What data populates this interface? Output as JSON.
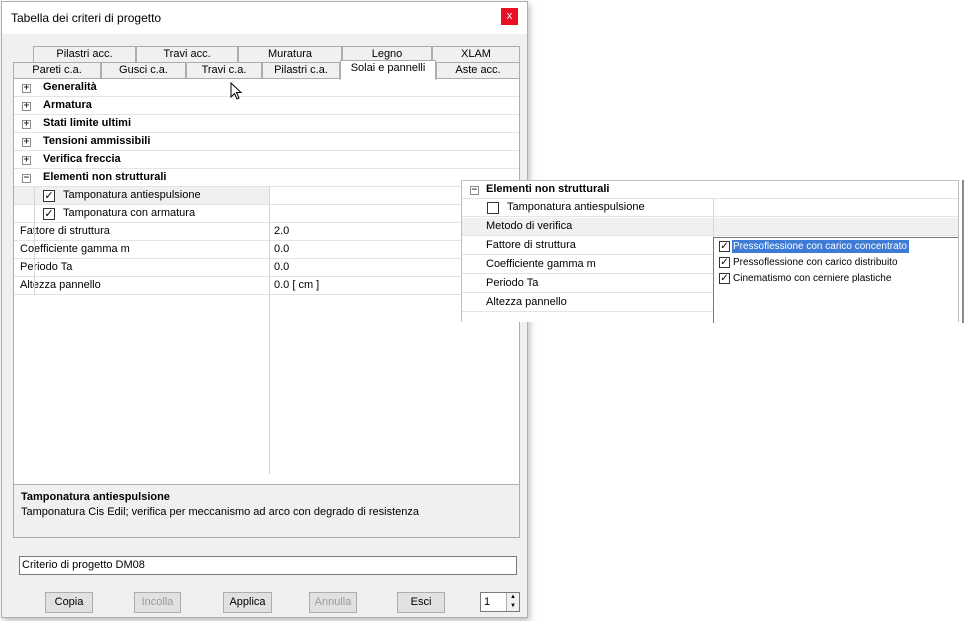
{
  "window": {
    "title": "Tabella dei criteri di progetto",
    "close_glyph": "x"
  },
  "tabs_row1": [
    {
      "label": "Pilastri acc."
    },
    {
      "label": "Travi acc."
    },
    {
      "label": "Muratura"
    },
    {
      "label": "Legno"
    },
    {
      "label": "XLAM"
    }
  ],
  "tabs_row2": [
    {
      "label": "Pareti c.a."
    },
    {
      "label": "Gusci c.a."
    },
    {
      "label": "Travi c.a."
    },
    {
      "label": "Pilastri c.a."
    },
    {
      "label": "Solai e pannelli",
      "active": true
    },
    {
      "label": "Aste acc."
    }
  ],
  "grid": {
    "categories": [
      {
        "label": "Generalità",
        "expander": "+"
      },
      {
        "label": "Armatura",
        "expander": "+"
      },
      {
        "label": "Stati limite ultimi",
        "expander": "+"
      },
      {
        "label": "Tensioni ammissibili",
        "expander": "+"
      },
      {
        "label": "Verifica freccia",
        "expander": "+"
      },
      {
        "label": "Elementi non strutturali",
        "expander": "−"
      }
    ],
    "rows": [
      {
        "label": "Tamponatura antiespulsione",
        "checked": true,
        "value": ""
      },
      {
        "label": "Tamponatura con armatura",
        "checked": true,
        "value": ""
      },
      {
        "label": "Fattore di struttura",
        "value": "2.0"
      },
      {
        "label": "Coefficiente gamma m",
        "value": "0.0"
      },
      {
        "label": "Periodo Ta",
        "value": "0.0"
      },
      {
        "label": "Altezza pannello",
        "value": "0.0  [ cm ]"
      }
    ],
    "check_glyph": "✓"
  },
  "description": {
    "title": "Tamponatura antiespulsione",
    "text": "Tamponatura Cis Edil; verifica per meccanismo ad arco con degrado di resistenza"
  },
  "criterio": {
    "value": "Criterio di progetto DM08"
  },
  "buttons": {
    "copia": "Copia",
    "incolla": "Incolla",
    "applica": "Applica",
    "annulla": "Annulla",
    "esci": "Esci"
  },
  "spinner": {
    "value": "1",
    "up": "▲",
    "down": "▼"
  },
  "zoom": {
    "category": {
      "label": "Elementi non strutturali",
      "expander": "−"
    },
    "rows": [
      {
        "label": "Tamponatura antiespulsione",
        "checked": false
      },
      {
        "label": "Metodo di verifica"
      },
      {
        "label": "Fattore di struttura"
      },
      {
        "label": "Coefficiente gamma m"
      },
      {
        "label": "Periodo Ta"
      },
      {
        "label": "Altezza pannello"
      }
    ],
    "options": [
      {
        "label": "Pressoflessione con carico concentrato",
        "checked": true,
        "selected": true
      },
      {
        "label": "Pressoflessione con carico distribuito",
        "checked": true
      },
      {
        "label": "Cinematismo con cerniere plastiche",
        "checked": true
      }
    ]
  },
  "colors": {
    "selection": "#3e7bd6",
    "close": "#e81123",
    "dialog_bg": "#f0f0f0"
  }
}
